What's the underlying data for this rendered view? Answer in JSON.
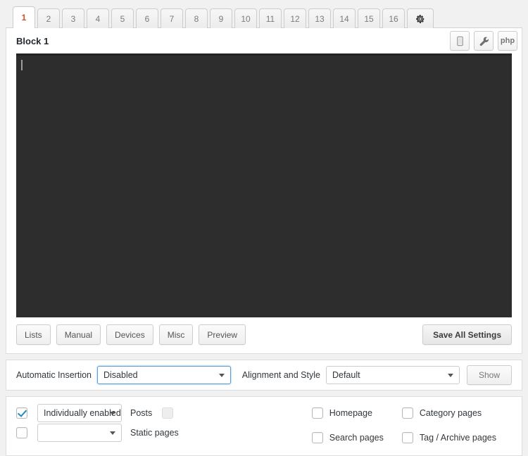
{
  "tabs": {
    "items": [
      {
        "label": "1",
        "active": true
      },
      {
        "label": "2",
        "active": false
      },
      {
        "label": "3",
        "active": false
      },
      {
        "label": "4",
        "active": false
      },
      {
        "label": "5",
        "active": false
      },
      {
        "label": "6",
        "active": false
      },
      {
        "label": "7",
        "active": false
      },
      {
        "label": "8",
        "active": false
      },
      {
        "label": "9",
        "active": false
      },
      {
        "label": "10",
        "active": false
      },
      {
        "label": "11",
        "active": false
      },
      {
        "label": "12",
        "active": false
      },
      {
        "label": "13",
        "active": false
      },
      {
        "label": "14",
        "active": false
      },
      {
        "label": "15",
        "active": false
      },
      {
        "label": "16",
        "active": false
      }
    ],
    "settings_tab_icon": "gear-icon",
    "active_tab_color": "#d54e21"
  },
  "block": {
    "title": "Block 1",
    "tools": [
      {
        "name": "device-icon",
        "label": ""
      },
      {
        "name": "wrench-icon",
        "label": ""
      },
      {
        "name": "php-button",
        "label": "php"
      }
    ],
    "editor": {
      "content": "",
      "background": "#2d2d2d",
      "caret_visible": true
    }
  },
  "actions": {
    "buttons": [
      {
        "label": "Lists"
      },
      {
        "label": "Manual"
      },
      {
        "label": "Devices"
      },
      {
        "label": "Misc"
      },
      {
        "label": "Preview"
      }
    ],
    "save_label": "Save All Settings"
  },
  "insertion": {
    "automatic_insertion_label": "Automatic Insertion",
    "automatic_insertion_value": "Disabled",
    "alignment_label": "Alignment and Style",
    "alignment_value": "Default",
    "show_label": "Show"
  },
  "display": {
    "rows": [
      {
        "checked": true,
        "select_value": "Individually enabled",
        "label": "Posts",
        "extra_checkbox": true,
        "extra_checkbox_disabled": true
      },
      {
        "checked": false,
        "select_value": "",
        "label": "Static pages",
        "extra_checkbox": false,
        "extra_checkbox_disabled": false
      }
    ],
    "page_types": [
      {
        "label": "Homepage",
        "checked": false
      },
      {
        "label": "Category pages",
        "checked": false
      },
      {
        "label": "Search pages",
        "checked": false
      },
      {
        "label": "Tag / Archive pages",
        "checked": false
      }
    ]
  }
}
